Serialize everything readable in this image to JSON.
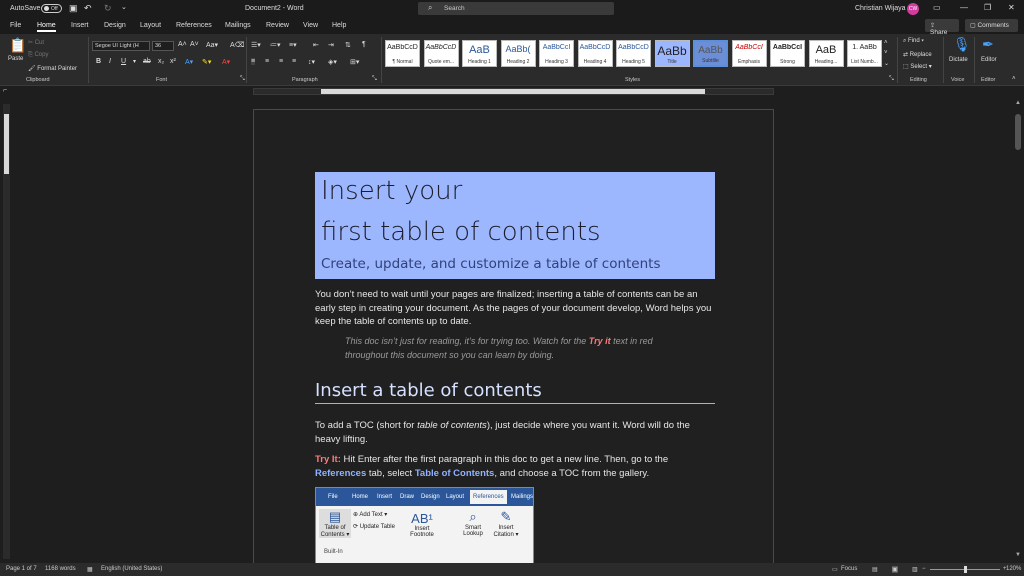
{
  "titlebar": {
    "autosave_label": "AutoSave",
    "autosave_state": "Off",
    "doc_title": "Document2 - Word",
    "search_placeholder": "Search",
    "user_name": "Christian Wijaya",
    "user_initials": "CW"
  },
  "menu": {
    "tabs": [
      "File",
      "Home",
      "Insert",
      "Design",
      "Layout",
      "References",
      "Mailings",
      "Review",
      "View",
      "Help"
    ],
    "active": "Home",
    "share_label": "Share",
    "comments_label": "Comments"
  },
  "ribbon": {
    "clipboard": {
      "paste": "Paste",
      "cut": "Cut",
      "copy": "Copy",
      "format_painter": "Format Painter",
      "label": "Clipboard"
    },
    "font": {
      "family": "Segoe UI Light (H",
      "size": "36",
      "label": "Font"
    },
    "paragraph": {
      "label": "Paragraph"
    },
    "styles": {
      "label": "Styles",
      "items": [
        {
          "preview": "AaBbCcD",
          "name": "¶ Normal"
        },
        {
          "preview": "AaBbCcD",
          "name": "Quote em..."
        },
        {
          "preview": "AaB",
          "name": "Heading 1"
        },
        {
          "preview": "AaBb(",
          "name": "Heading 2"
        },
        {
          "preview": "AaBbCcI",
          "name": "Heading 3"
        },
        {
          "preview": "AaBbCcD",
          "name": "Heading 4"
        },
        {
          "preview": "AaBbCcD",
          "name": "Heading 5"
        },
        {
          "preview": "AaBb",
          "name": "Title"
        },
        {
          "preview": "AaBb",
          "name": "Subtitle"
        },
        {
          "preview": "AaBbCcI",
          "name": "Emphasis"
        },
        {
          "preview": "AaBbCcI",
          "name": "Strong"
        },
        {
          "preview": "AaB",
          "name": "Heading..."
        },
        {
          "preview": "1. AaBb",
          "name": "List Numb..."
        }
      ]
    },
    "editing": {
      "find": "Find",
      "replace": "Replace",
      "select": "Select",
      "label": "Editing"
    },
    "voice": {
      "dictate": "Dictate",
      "label": "Voice"
    },
    "editor": {
      "editor": "Editor",
      "label": "Editor"
    }
  },
  "document": {
    "banner_line1": "Insert your",
    "banner_line2": "first table of contents",
    "banner_sub": "Create, update, and customize a table of contents",
    "intro": "You don’t need to wait until your pages are finalized; inserting a table of contents can be an early step in creating your document. As the pages of your document develop, Word helps you keep the table of contents up to date.",
    "quote_pre": "This doc isn’t just for reading, it’s for trying too. Watch for the ",
    "quote_try": "Try it",
    "quote_post": " text in red throughout this document so you can learn by doing.",
    "heading2": "Insert a table of contents",
    "toc_pre": "To add a TOC (short for ",
    "toc_em": "table of contents",
    "toc_post": "), just decide where you want it. Word will do the heavy lifting.",
    "try_label": "Try It:",
    "try_text1": " Hit Enter after the first paragraph in this doc to get a new line. Then, go to the ",
    "try_refs": "References",
    "try_text2": " tab, select ",
    "try_toc": "Table of Contents",
    "try_text3": ", and choose a TOC from the gallery."
  },
  "image": {
    "tabs": [
      "File",
      "Home",
      "Insert",
      "Draw",
      "Design",
      "Layout",
      "References",
      "Mailings"
    ],
    "items": {
      "toc": "Table of Contents ▾",
      "add_text": "Add Text ▾",
      "update_table": "Update Table",
      "insert_footnote": "Insert Footnote",
      "smart_lookup": "Smart Lookup",
      "insert_citation": "Insert Citation ▾",
      "built_in": "Built-In"
    }
  },
  "status": {
    "page": "Page 1 of 7",
    "words": "1168 words",
    "language": "English (United States)",
    "focus": "Focus",
    "zoom": "120%"
  }
}
